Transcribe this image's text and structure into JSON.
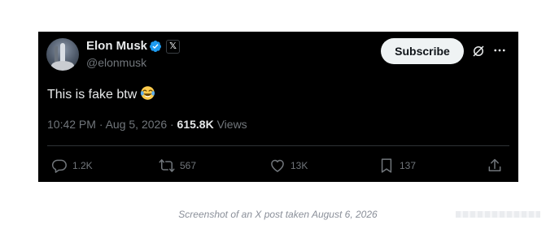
{
  "post": {
    "author": {
      "display_name": "Elon Musk",
      "handle": "@elonmusk",
      "verified": true,
      "verified_color": "#1d9bf0",
      "affiliate_badge": "𝕏"
    },
    "subscribe_label": "Subscribe",
    "text": "This is fake btw",
    "emoji": "face-with-tears-of-joy-icon",
    "timestamp": "10:42 PM · Aug 5, 2026 · ",
    "views_count": "615.8K",
    "views_label": " Views",
    "actions": {
      "replies": "1.2K",
      "reposts": "567",
      "likes": "13K",
      "bookmarks": "137"
    },
    "icons": [
      "grok-icon",
      "more-icon",
      "reply-icon",
      "repost-icon",
      "like-icon",
      "bookmark-icon",
      "share-icon"
    ]
  },
  "caption": "Screenshot of an X post taken August 6, 2026",
  "colors": {
    "post_background": "#000000",
    "primary_text": "#e7e9ea",
    "secondary_text": "#71767b",
    "subscribe_bg": "#eff3f4"
  }
}
